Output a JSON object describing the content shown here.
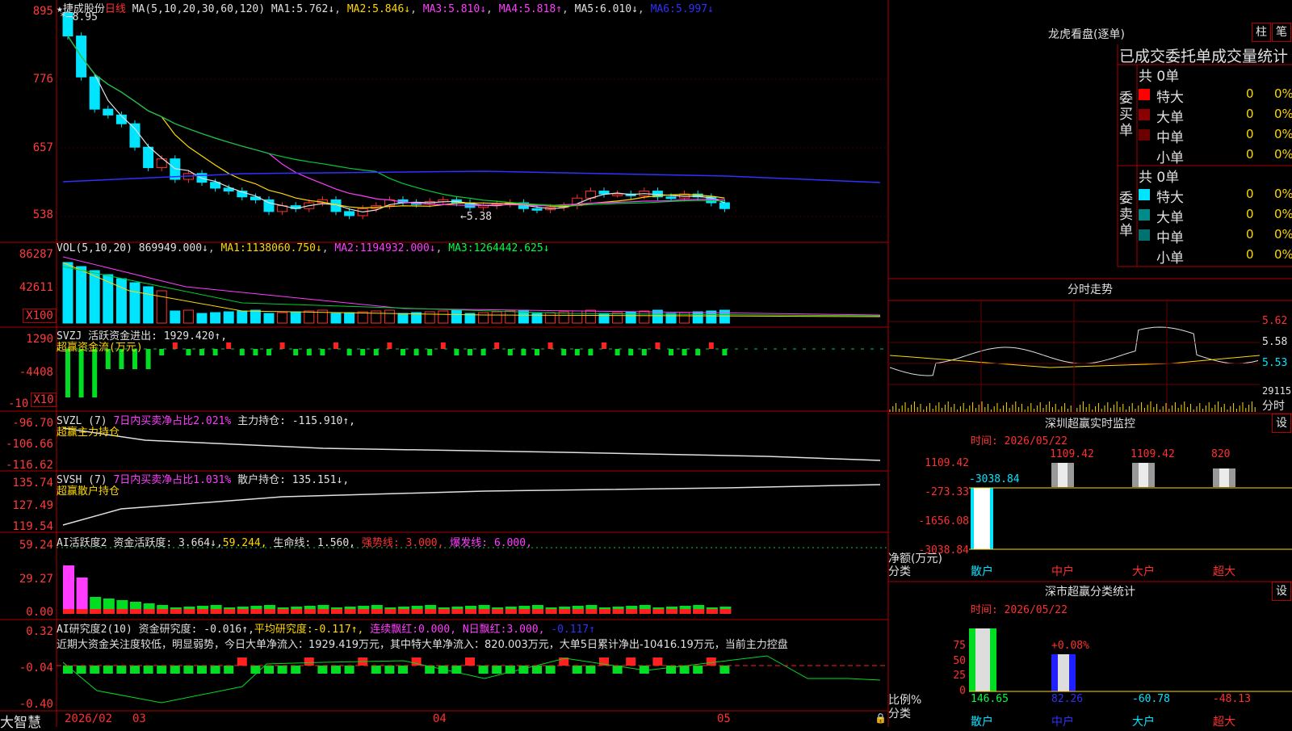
{
  "stock": {
    "name": "捷成股份",
    "period": "日线"
  },
  "main": {
    "axis": [
      "895",
      "776",
      "657",
      "538"
    ],
    "max_marker": "8.95",
    "min_marker": "5.38",
    "ma_label": "MA(5,10,20,30,60,120)",
    "ma": [
      {
        "k": "MA1:",
        "v": "5.762↓"
      },
      {
        "k": "MA2:",
        "v": "5.846↓"
      },
      {
        "k": "MA3:",
        "v": "5.810↓"
      },
      {
        "k": "MA4:",
        "v": "5.818↑"
      },
      {
        "k": "MA5:",
        "v": "6.010↓"
      },
      {
        "k": "MA6:",
        "v": "5.997↓"
      }
    ]
  },
  "vol": {
    "axis": [
      "86287",
      "42611",
      "X100"
    ],
    "label": "VOL(5,10,20)",
    "val": "869949.000↓",
    "ma": [
      {
        "k": "MA1:",
        "v": "1138060.750↓"
      },
      {
        "k": "MA2:",
        "v": "1194932.000↓"
      },
      {
        "k": "MA3:",
        "v": "1264442.625↓"
      }
    ]
  },
  "svzj": {
    "axis": [
      "1290",
      "-4408",
      "-10",
      "X10"
    ],
    "label": "SVZJ",
    "item": "活跃资金进出:",
    "val": "1929.420↑,",
    "sub": "超赢资金流(万元)"
  },
  "svzl": {
    "axis": [
      "-96.70",
      "-106.66",
      "-116.62"
    ],
    "label": "SVZL (7)",
    "txt": "7日内买卖净占比2.021%",
    "item": "主力持仓:",
    "val": "-115.910↑,",
    "sub": "超赢主力持仓"
  },
  "svsh": {
    "axis": [
      "135.74",
      "127.49",
      "119.54"
    ],
    "label": "SVSH (7)",
    "txt": "7日内买卖净占比1.031%",
    "item": "散户持仓:",
    "val": "135.151↓,",
    "sub": "超赢散户持仓"
  },
  "ai1": {
    "axis": [
      "59.24",
      "29.27",
      "0.00"
    ],
    "label": "AI活跃度2",
    "k1": "资金活跃度:",
    "v1": "3.664↓,",
    "v2": "59.244,",
    "k3": "生命线:",
    "v3": "1.560,",
    "k4": "强势线:",
    "v4": "3.000,",
    "k5": "爆发线:",
    "v5": "6.000,"
  },
  "ai2": {
    "axis": [
      "0.32",
      "-0.04",
      "-0.40"
    ],
    "label": "AI研究度2(10)",
    "k1": "资金研究度:",
    "v1": "-0.016↑,",
    "k2": "平均研究度:",
    "v2": "-0.117↑,",
    "k3": "连续飘红:",
    "v3": "0.000,",
    "k4": "N日飘红:",
    "v4": "3.000,",
    "v5": "-0.117↑",
    "desc": "近期大资金关注度较低，明显弱势，今日大单净流入：1929.419万元，其中特大单净流入：820.003万元，大单5日累计净出-10416.19万元，当前主力控盘"
  },
  "xaxis": {
    "brand": "大智慧",
    "labels": [
      "2026/02",
      "03",
      "04",
      "05"
    ]
  },
  "right": {
    "lhkp": "龙虎看盘(逐单)",
    "btn1": "柱",
    "btn2": "笔",
    "tbl_title": "已成交委托单成交量统计",
    "buy_side": "委买单",
    "sell_side": "委卖单",
    "buy_total": "共 0单",
    "sell_total": "共 0单",
    "buy_rows": [
      {
        "n": "特大",
        "v": "0",
        "p": "0%",
        "c": "#ff0000"
      },
      {
        "n": "大单",
        "v": "0",
        "p": "0%",
        "c": "#8b0000"
      },
      {
        "n": "中单",
        "v": "0",
        "p": "0%",
        "c": "#6a0000"
      },
      {
        "n": "小单",
        "v": "0",
        "p": "0%",
        "c": ""
      }
    ],
    "sell_rows": [
      {
        "n": "特大",
        "v": "0",
        "p": "0%",
        "c": "#00e5ff"
      },
      {
        "n": "大单",
        "v": "0",
        "p": "0%",
        "c": "#008b8b"
      },
      {
        "n": "中单",
        "v": "0",
        "p": "0%",
        "c": "#007070"
      },
      {
        "n": "小单",
        "v": "0",
        "p": "0%",
        "c": ""
      }
    ],
    "fs_title": "分时走势",
    "fs_axis": [
      "5.62",
      "5.58",
      "5.53"
    ],
    "fs_vol": "29115",
    "fs_vol_lbl": "分时",
    "sz_title": "深圳超赢实时监控",
    "set": "设",
    "date_lbl": "时间: 2026/05/22",
    "sz_axis": [
      "1109.42",
      "-273.33",
      "-1656.08",
      "-3038.84"
    ],
    "sz_vals": [
      "-3038.84",
      "1109.42",
      "1109.42",
      "820"
    ],
    "net_lbl": "净额(万元)",
    "cls_lbl": "分类",
    "cats": [
      "散户",
      "中户",
      "大户",
      "超大"
    ],
    "ss_title": "深市超赢分类统计",
    "ss_date": "时间: 2026/05/22",
    "ss_axis": [
      "75",
      "50",
      "25",
      "0"
    ],
    "ratio_lbl": "比例%",
    "ss_badge": "+0.08%",
    "ss_vals": [
      "146.65",
      "82.26",
      "-60.78",
      "-48.13"
    ]
  },
  "chart_data": {
    "type": "candlestick",
    "series": [
      {
        "name": "price",
        "values": [
          8.55,
          7.85,
          7.3,
          7.2,
          7.05,
          6.65,
          6.3,
          6.45,
          6.1,
          6.2,
          6.05,
          5.95,
          5.9,
          5.8,
          5.75,
          5.55,
          5.65,
          5.6,
          5.7,
          5.75,
          5.55,
          5.48,
          5.6,
          5.65,
          5.75,
          5.7,
          5.68,
          5.72,
          5.75,
          5.7,
          5.62,
          5.65,
          5.68,
          5.7,
          5.6,
          5.58,
          5.62,
          5.65,
          5.78,
          5.9,
          5.85,
          5.85,
          5.82,
          5.9,
          5.8,
          5.78,
          5.85,
          5.8,
          5.7,
          5.6
        ]
      }
    ]
  }
}
